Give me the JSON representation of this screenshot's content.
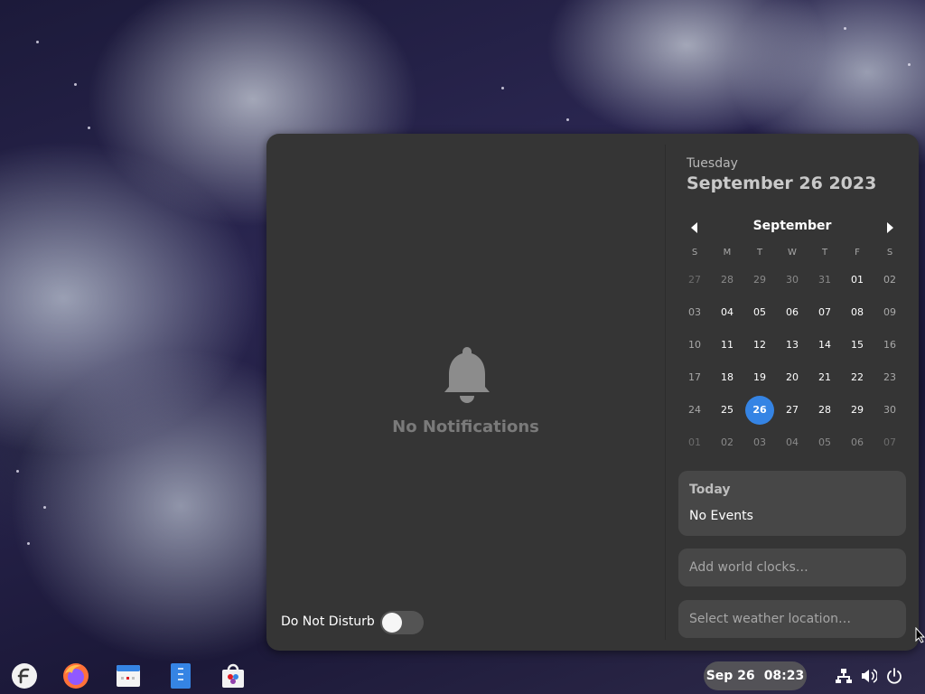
{
  "notifications": {
    "empty_text": "No Notifications",
    "dnd_label": "Do Not Disturb",
    "dnd_enabled": false
  },
  "calendar": {
    "weekday": "Tuesday",
    "full_date": "September 26 2023",
    "month": "September",
    "day_headers": [
      "S",
      "M",
      "T",
      "W",
      "T",
      "F",
      "S"
    ],
    "weeks": [
      [
        "27",
        "28",
        "29",
        "30",
        "31",
        "01",
        "02"
      ],
      [
        "03",
        "04",
        "05",
        "06",
        "07",
        "08",
        "09"
      ],
      [
        "10",
        "11",
        "12",
        "13",
        "14",
        "15",
        "16"
      ],
      [
        "17",
        "18",
        "19",
        "20",
        "21",
        "22",
        "23"
      ],
      [
        "24",
        "25",
        "26",
        "27",
        "28",
        "29",
        "30"
      ],
      [
        "01",
        "02",
        "03",
        "04",
        "05",
        "06",
        "07"
      ]
    ],
    "selected_day": "26",
    "today_title": "Today",
    "today_events": "No Events",
    "world_clocks": "Add world clocks…",
    "weather": "Select weather location…"
  },
  "panel": {
    "date": "Sep 26",
    "time": "08:23",
    "dash": [
      "fedora-icon",
      "firefox-icon",
      "calendar-app-icon",
      "files-icon",
      "software-icon"
    ],
    "tray": [
      "network-icon",
      "volume-icon",
      "power-icon"
    ],
    "accent": "#3584e4"
  }
}
